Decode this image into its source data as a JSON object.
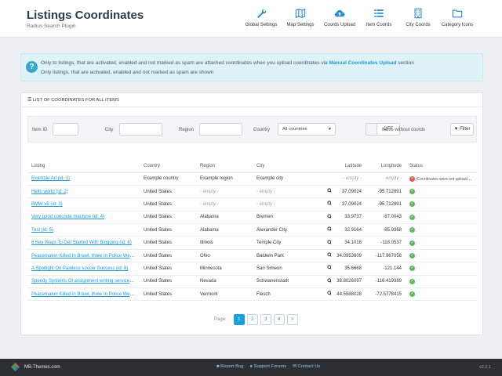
{
  "header": {
    "title": "Listings Coordinates",
    "subtitle": "Radius Search Plugin",
    "nav": [
      {
        "label": "Global Settings",
        "icon": "wrench-icon"
      },
      {
        "label": "Map Settings",
        "icon": "map-icon"
      },
      {
        "label": "Coords Upload",
        "icon": "cloud-upload-icon"
      },
      {
        "label": "Item Coords",
        "icon": "list-icon"
      },
      {
        "label": "City Coords",
        "icon": "building-icon"
      },
      {
        "label": "Category Icons",
        "icon": "folder-icon"
      }
    ]
  },
  "info": {
    "line1_prefix": "Only to listings, that are activated, enabled and not marked as spam are attached coordinates when you upload coordinates via",
    "line1_link": "Manual Coordinates Upload",
    "line1_suffix": "section",
    "line2": "Only listings, that are activated, enabled and not marked as spam are shown"
  },
  "panel": {
    "title": "LIST OF COORDINATES FOR ALL ITEMS"
  },
  "filters": {
    "item_id_label": "Item ID",
    "item_id_value": "",
    "city_label": "City",
    "city_value": "",
    "region_label": "Region",
    "region_value": "",
    "country_label": "Country",
    "country_value": "All countries",
    "toggle_state": "OFF",
    "toggle_label": "Items without coords",
    "filter_button": "Filter"
  },
  "table": {
    "columns": [
      "Listing",
      "Country",
      "Region",
      "City",
      "Latitude",
      "Longitude",
      "Status"
    ],
    "rows": [
      {
        "listing": "Example Ad (id: 1)",
        "country": "Example country",
        "region": "Example region",
        "city": "Example city",
        "lat": "- empty -",
        "lng": "- empty -",
        "status": "error",
        "status_text": "(Coordinates were not uploaded y..."
      },
      {
        "listing": "Hello world (id: 2)",
        "country": "United States",
        "region": "- empty -",
        "city": "- empty -",
        "lat": "37.09024",
        "lng": "-95.712891",
        "status": "ok"
      },
      {
        "listing": "BMW x5 (id: 3)",
        "country": "United States",
        "region": "- empty -",
        "city": "- empty -",
        "lat": "37.09024",
        "lng": "-95.712891",
        "status": "ok"
      },
      {
        "listing": "Very good concrete machine (id: 4)",
        "country": "United States",
        "region": "Alabama",
        "city": "Bremen",
        "lat": "33.9737",
        "lng": "-87.0043",
        "status": "ok"
      },
      {
        "listing": "Test (id: 5)",
        "country": "United States",
        "region": "Alabama",
        "city": "Alexander City",
        "lat": "32.9164",
        "lng": "-85.9368",
        "status": "ok"
      },
      {
        "listing": "6 Key Ways To Get Started With Blogging (id: 6)",
        "country": "United States",
        "region": "Illinois",
        "city": "Temple City",
        "lat": "34.1016",
        "lng": "-118.0537",
        "status": "ok"
      },
      {
        "listing": "Peacemaker Killed In Brawl, three In Police Web (i...",
        "country": "United States",
        "region": "Ohio",
        "city": "Baldwin Park",
        "lat": "34.0953609",
        "lng": "-117.967058",
        "status": "ok"
      },
      {
        "listing": "A Spotlight On Painless soccer Success (id: 8)",
        "country": "United States",
        "region": "Minnesota",
        "city": "San Simeon",
        "lat": "35.6668",
        "lng": "-121.144",
        "status": "ok"
      },
      {
        "listing": "Speedy Systems Of assignment writing services - ...",
        "country": "United States",
        "region": "Nevada",
        "city": "Schwanenstadt",
        "lat": "38.8026097",
        "lng": "-116.419389",
        "status": "ok"
      },
      {
        "listing": "Peacemaker Killed In Brawl, three In Police Web (i...",
        "country": "United States",
        "region": "Vermont",
        "city": "Fiesch",
        "lat": "44.5588028",
        "lng": "-72.5778415",
        "status": "ok"
      }
    ]
  },
  "pagination": {
    "label": "Page:",
    "pages": [
      "1",
      "2",
      "3",
      "4"
    ],
    "active": "1",
    "next": ">"
  },
  "footer": {
    "brand": "MB-Themes.com",
    "links": [
      "Report Bug",
      "Support Forums",
      "Contact Us"
    ],
    "version": "v2.2.1"
  },
  "colors": {
    "accent": "#19a0dc",
    "ok": "#5cb85c",
    "error": "#e05a50",
    "footer_bg": "#2d2f33"
  }
}
